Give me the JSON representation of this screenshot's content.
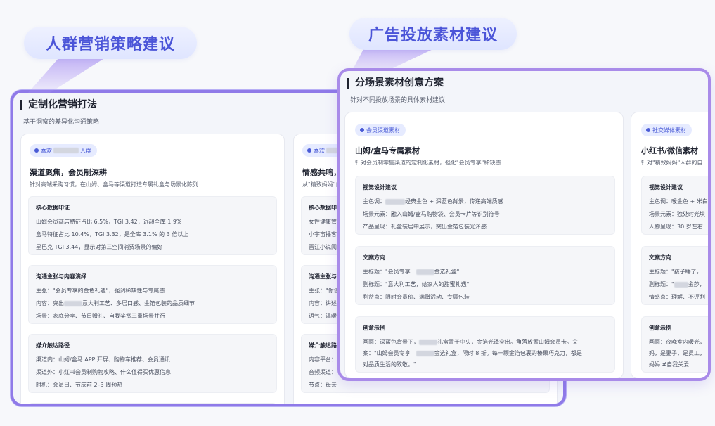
{
  "tags": {
    "left": "人群营销策略建议",
    "right": "广告投放素材建议"
  },
  "panel1": {
    "title": "定制化营销打法",
    "subtitle": "基于洞察的差异化沟通策略",
    "card1": {
      "pill_pre": "喜欢",
      "pill_post": "人群",
      "title": "渠道聚焦，会员制深耕",
      "subtitle": "针对高端采购习惯，在山姆、盒马等渠道打造专属礼盒与场景化陈列",
      "sections": [
        {
          "heading": "核心数据印证",
          "lines": [
            "山姆会员商店特征占比 6.5%，TGI 3.42，远超全库 1.9%",
            "盒马特征占比 10.4%，TGI 3.32，是全库 3.1% 的 3 倍以上",
            "星巴克 TGI 3.44，显示对第三空间消费场景的偏好"
          ]
        },
        {
          "heading": "沟通主张与内容演绎",
          "lines": [
            "主张：\"会员专享的金色礼遇\"，强调稀缺性与专属感",
            "内容：突出",
            "意大利工艺、多层口感、金箔包装的品质细节",
            "场景：家庭分享、节日赠礼、自我奖赏三重场景并行"
          ]
        },
        {
          "heading": "媒介触达路径",
          "lines": [
            "渠道内：山姆/盒马 APP 开屏、购物车推荐、会员通讯",
            "渠道外：小红书会员制购物攻略、什么值得买优惠信息",
            "时机：会员日、节庆前 2–3 周预热"
          ]
        }
      ]
    },
    "card2": {
      "pill_pre": "喜欢",
      "title": "情感共鸣，",
      "subtitle": "从\"精致妈妈\"自",
      "sections": [
        {
          "heading": "核心数据印",
          "lines": [
            "女性健康管",
            "小宇宙播客",
            "晋江小说阅"
          ]
        },
        {
          "heading": "沟通主张与",
          "lines": [
            "主张：\"你值",
            "内容：讲述",
            "语气：温暖"
          ]
        },
        {
          "heading": "媒介触达路",
          "lines": [
            "内容平台：",
            "音频渠道：",
            "节点：母亲"
          ]
        }
      ]
    }
  },
  "panel2": {
    "title": "分场景素材创意方案",
    "subtitle": "针对不同投放场景的具体素材建议",
    "card1": {
      "pill": "会员渠道素材",
      "title": "山姆/盒马专属素材",
      "subtitle": "针对会员制零售渠道的定制化素材，强化\"会员专享\"稀缺感",
      "sec1": {
        "heading": "视觉设计建议",
        "l1_pre": "主色调：",
        "l1_post": "经典金色 + 深蓝色背景，传递高端质感",
        "l2": "场景元素：融入山姆/盒马购物袋、会员卡片等识别符号",
        "l3": "产品呈现：礼盒装居中展示，突出金箔包装光泽感"
      },
      "sec2": {
        "heading": "文案方向",
        "l1_pre": "主标题：\"会员专享｜",
        "l1_post": "金选礼盒\"",
        "l2": "副标题：\"意大利工艺，给家人的甜蜜礼遇\"",
        "l3": "利益点：限时会员价、满赠活动、专属包装"
      },
      "sec3": {
        "heading": "创意示例",
        "l1_pre": "画面：深蓝色背景下，",
        "l1_post": "礼盒置于中央，金箔光泽突出。角落放置山姆会员卡。文",
        "l2_pre": "案：\"山姆会员专享｜",
        "l2_post": "金选礼盒，限时 8 折。每一颗金箔包裹的榛果巧克力，都是",
        "l3": "对品质生活的致敬。\""
      }
    },
    "card2": {
      "pill": "社交媒体素材",
      "title": "小红书/微信素材",
      "subtitle": "针对\"精致妈妈\"人群的自",
      "sec1": {
        "heading": "视觉设计建议",
        "lines": [
          "主色调：暖金色 + 米白",
          "场景元素：独处时光块",
          "人物呈现：30 岁左右"
        ]
      },
      "sec2": {
        "heading": "文案方向",
        "lines": [
          "主标题：\"孩子睡了，",
          "副标题：\"",
          "金莎，",
          "情感点：理解、不评判"
        ]
      },
      "sec3": {
        "heading": "创意示例",
        "lines": [
          "画面：夜晚室内暖光，",
          "妈，是妻子，是员工，",
          "妈妈 #自我关爱"
        ]
      }
    }
  }
}
